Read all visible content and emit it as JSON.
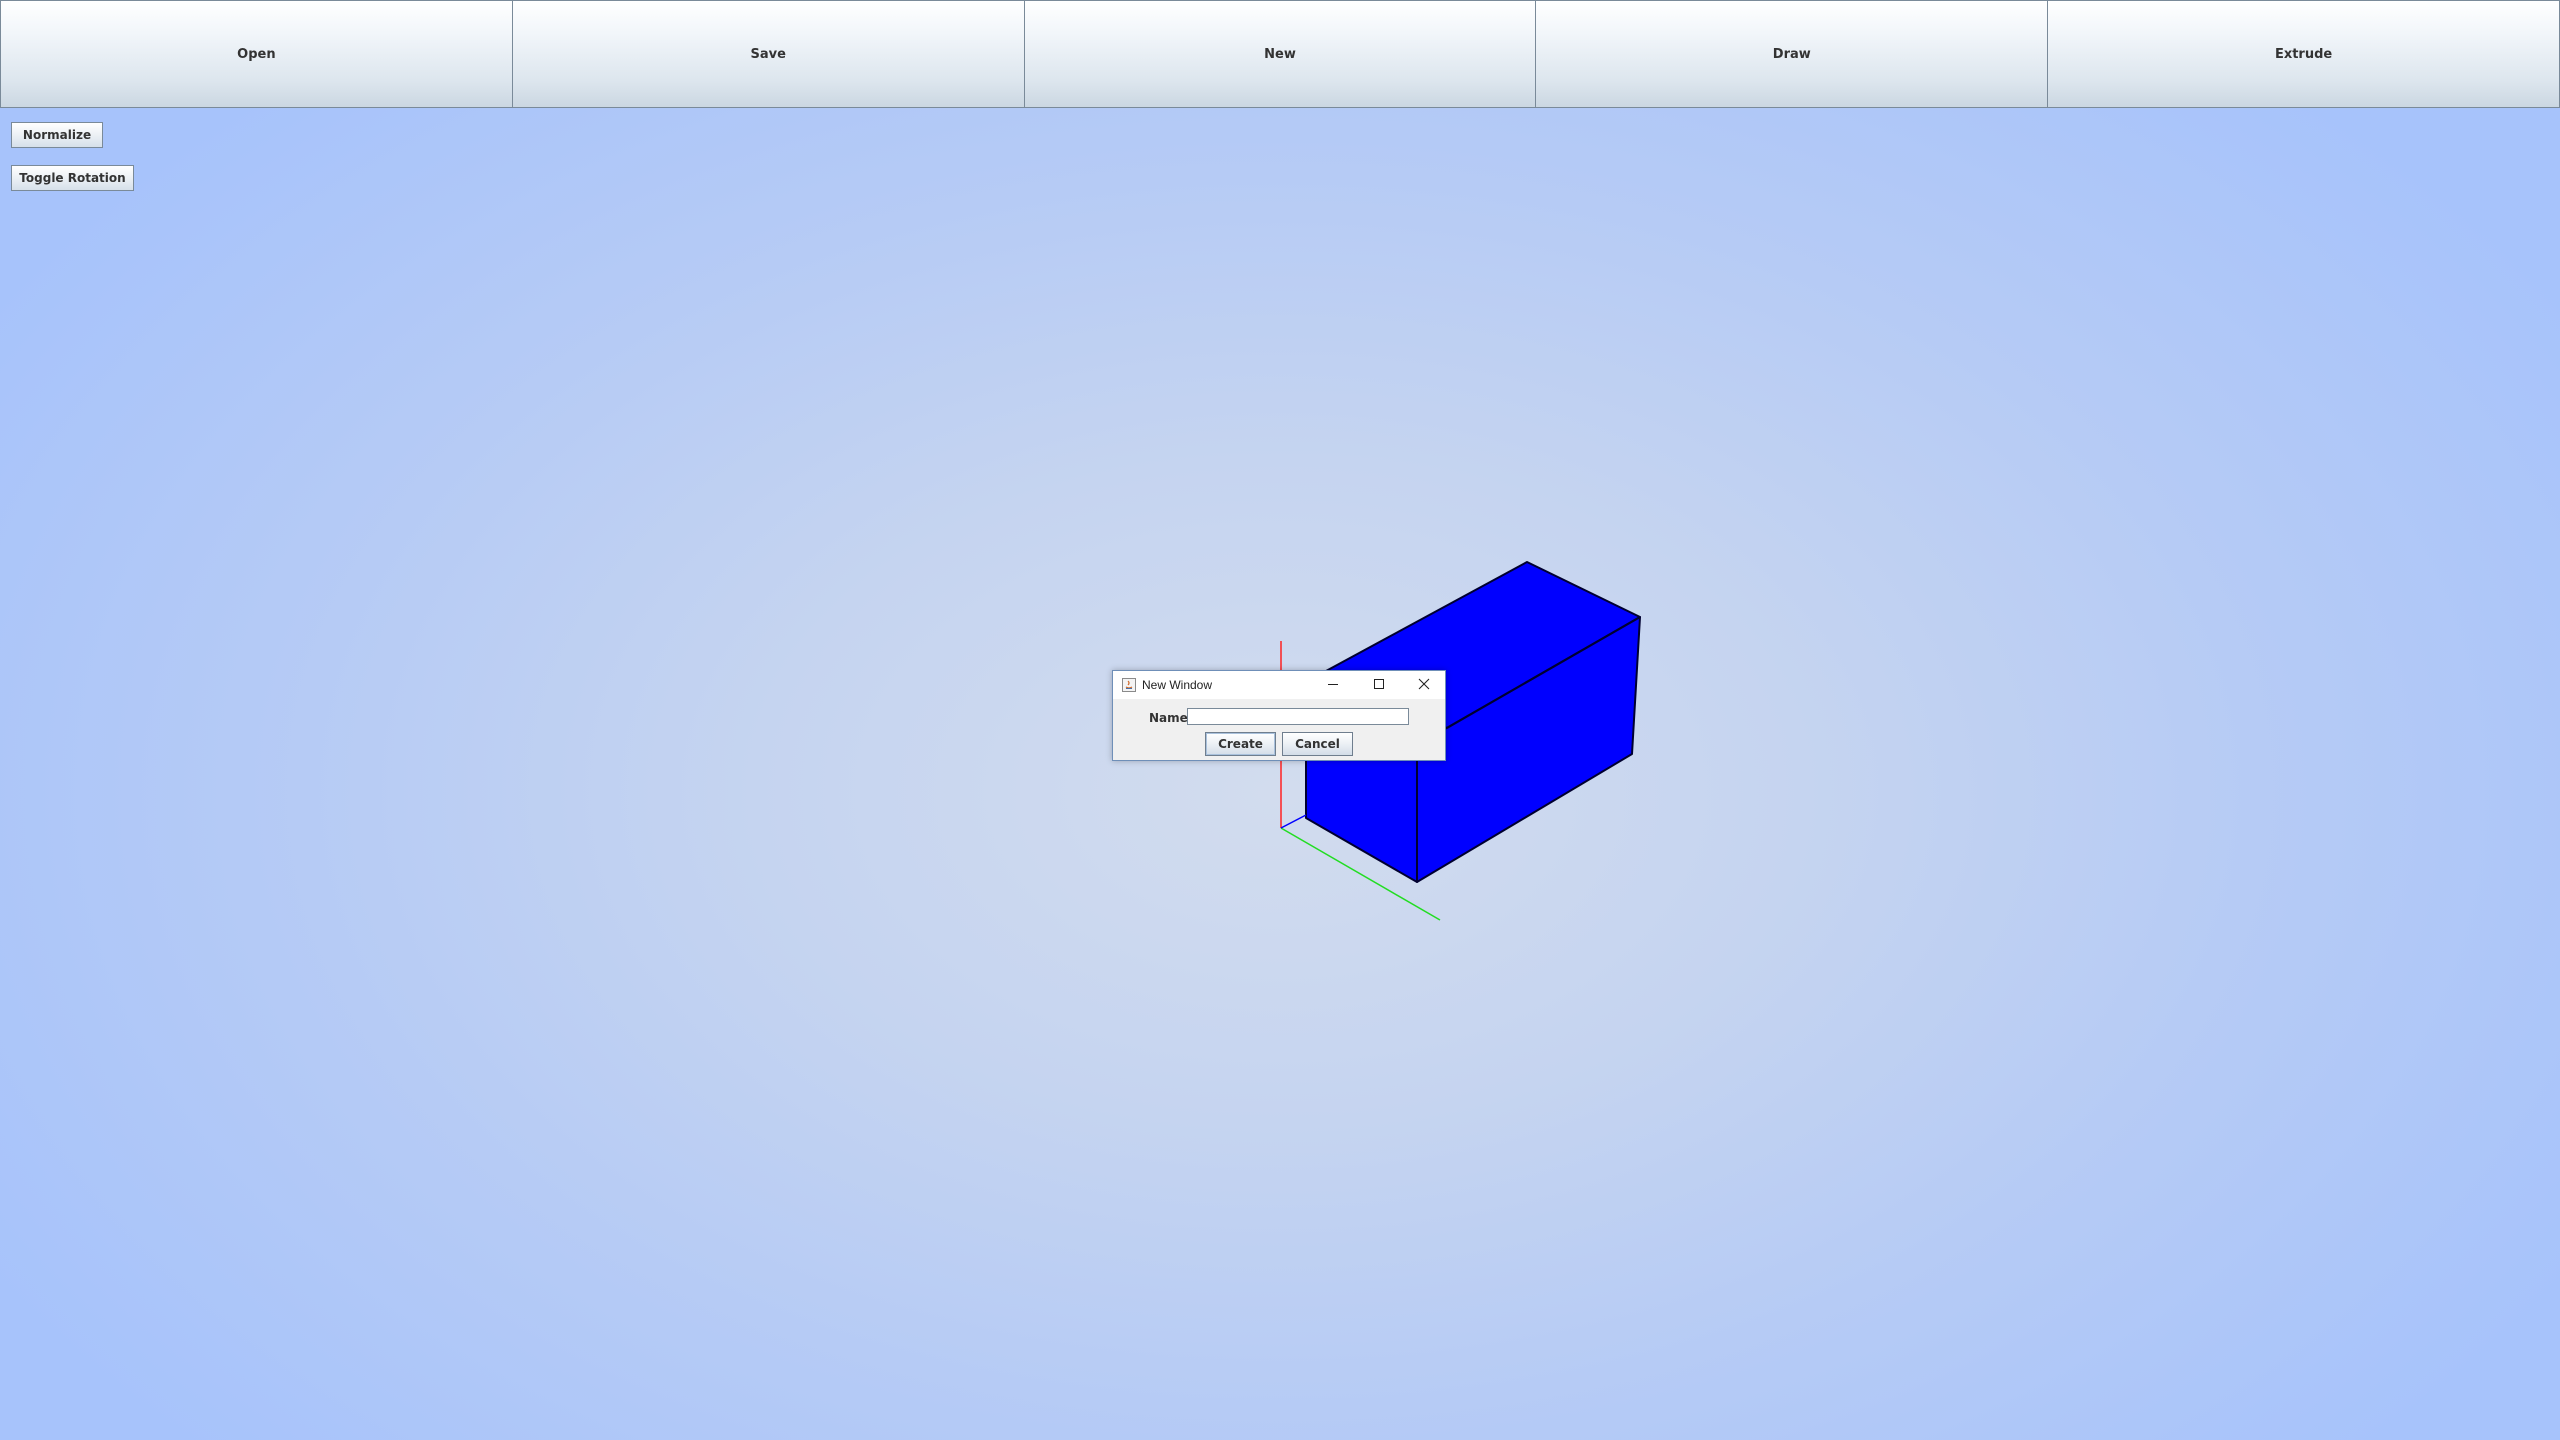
{
  "toolbar": {
    "buttons": [
      "Open",
      "Save",
      "New",
      "Draw",
      "Extrude"
    ]
  },
  "side_buttons": {
    "normalize": "Normalize",
    "toggle_rotation": "Toggle Rotation"
  },
  "viewport": {
    "object": "blue-box",
    "object_color": "#0000ff",
    "axis_colors": {
      "x": "#ff0000",
      "y": "#00cc00",
      "z": "#0000ff"
    }
  },
  "dialog": {
    "title": "New Window",
    "name_label": "Name",
    "name_value": "",
    "create_label": "Create",
    "cancel_label": "Cancel"
  }
}
